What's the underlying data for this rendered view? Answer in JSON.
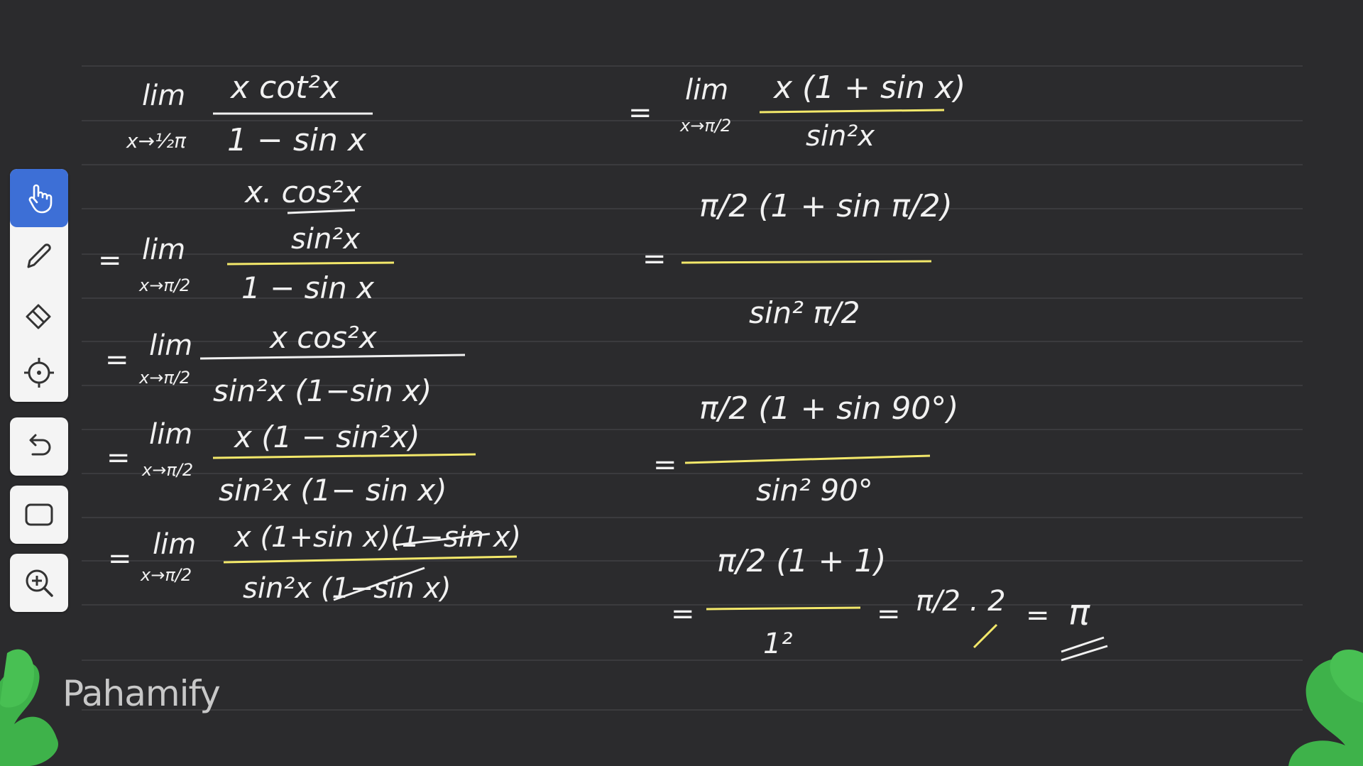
{
  "app": {
    "brand": "Pahamify",
    "brand_color": "#d9d9d9",
    "board_color": "#2b2b2d",
    "ink_color": "#f1f1f1",
    "highlight_color": "#f3e86a"
  },
  "toolbar": {
    "groups": [
      {
        "tools": [
          {
            "name": "hand-tool",
            "icon": "hand-icon",
            "active": true
          },
          {
            "name": "pen-tool",
            "icon": "pen-icon",
            "active": false
          },
          {
            "name": "eraser-tool",
            "icon": "eraser-icon",
            "active": false
          },
          {
            "name": "laser-tool",
            "icon": "crosshair-icon",
            "active": false
          }
        ]
      },
      {
        "tools": [
          {
            "name": "undo-tool",
            "icon": "undo-icon",
            "active": false
          }
        ]
      },
      {
        "tools": [
          {
            "name": "fullscreen-tool",
            "icon": "rectangle-icon",
            "active": false
          }
        ]
      },
      {
        "tools": [
          {
            "name": "zoom-tool",
            "icon": "zoom-in-icon",
            "active": false
          }
        ]
      }
    ]
  },
  "math": {
    "left": {
      "step1": {
        "lim": "lim",
        "sub": "x→½π",
        "num": "x cot²x",
        "den": "1 − sin x"
      },
      "step2": {
        "eq": "=",
        "lim": "lim",
        "sub": "x→π/2",
        "num_top": "x. cos²x",
        "num_bottom": "sin²x",
        "den": "1 − sin x"
      },
      "step3": {
        "eq": "=",
        "lim": "lim",
        "sub": "x→π/2",
        "num": "x cos²x",
        "den": "sin²x (1−sin x)"
      },
      "step4": {
        "eq": "=",
        "lim": "lim",
        "sub": "x→π/2",
        "num": "x (1 − sin²x)",
        "den": "sin²x (1− sin x)"
      },
      "step5": {
        "eq": "=",
        "lim": "lim",
        "sub": "x→π/2",
        "num": "x (1+sin x)(1−sin x)",
        "den": "sin²x (1−sin x)"
      }
    },
    "right": {
      "step1": {
        "eq": "=",
        "lim": "lim",
        "sub": "x→π/2",
        "num": "x (1 + sin x)",
        "den": "sin²x"
      },
      "step2": {
        "eq": "=",
        "num": "π/2 (1 + sin π/2)",
        "den": "sin² π/2"
      },
      "step3": {
        "eq": "=",
        "num": "π/2 (1 + sin 90°)",
        "den": "sin² 90°"
      },
      "step4": {
        "eq": "=",
        "num": "π/2 (1 + 1)",
        "den": "1²",
        "eq2": "=",
        "simplified": "π/2 . 2",
        "eq3": "=",
        "result": "π"
      }
    }
  }
}
